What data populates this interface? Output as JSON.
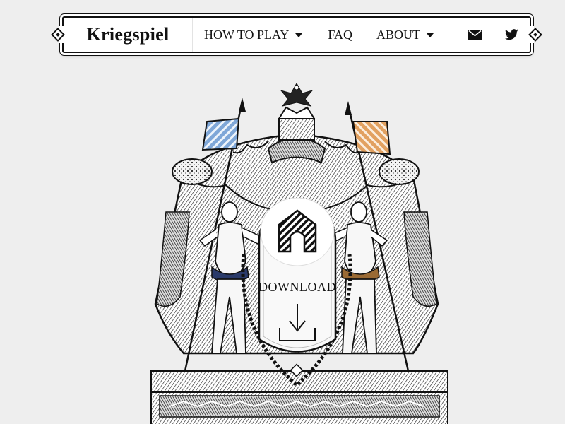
{
  "navbar": {
    "brand": "Kriegspiel",
    "items": [
      {
        "label": "HOW TO PLAY",
        "has_dropdown": true
      },
      {
        "label": "FAQ",
        "has_dropdown": false
      },
      {
        "label": "ABOUT",
        "has_dropdown": true
      }
    ],
    "icons": [
      "envelope-icon",
      "twitter-icon"
    ]
  },
  "hero": {
    "download_label": "DOWNLOAD",
    "icons": [
      "app-logo-icon",
      "download-arrow-icon"
    ]
  },
  "colors": {
    "background": "#eeeeee",
    "ink": "#111111",
    "left_flag": "#7fa7d8",
    "right_flag": "#e2a160",
    "left_belt": "#2a3a6a",
    "right_belt": "#9a6a34"
  }
}
